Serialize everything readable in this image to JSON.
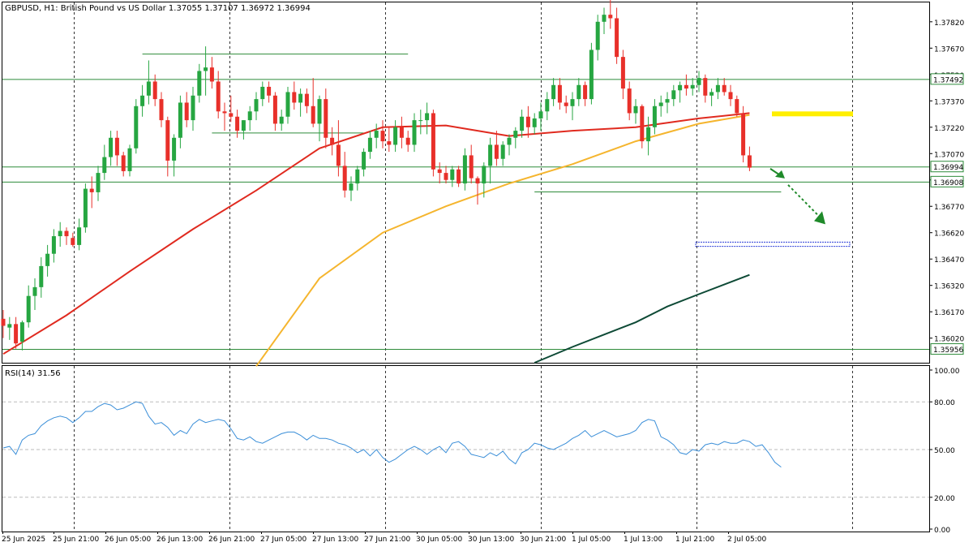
{
  "header": {
    "symbol_info": "GBPUSD, H1:  British Pound vs US Dollar  1.37055 1.37107 1.36972 1.36994"
  },
  "indicator": {
    "label": "RSI(14) 31.56"
  },
  "price_axis": {
    "ticks": [
      "1.37820",
      "1.37670",
      "1.37520",
      "1.37370",
      "1.37220",
      "1.37070",
      "1.36920",
      "1.36770",
      "1.36620",
      "1.36470",
      "1.36320",
      "1.36170",
      "1.36020"
    ],
    "tick_values": [
      1.3782,
      1.3767,
      1.3752,
      1.3737,
      1.3722,
      1.3707,
      1.3692,
      1.3677,
      1.3662,
      1.3647,
      1.3632,
      1.3617,
      1.3602
    ],
    "range": [
      1.3588,
      1.3793
    ]
  },
  "rsi_axis": {
    "ticks": [
      "100.00",
      "80.00",
      "50.00",
      "20.00",
      "0.00"
    ],
    "tick_values": [
      100,
      80,
      50,
      20,
      0
    ]
  },
  "time_axis": {
    "labels": [
      "25 Jun 2025",
      "25 Jun 21:00",
      "26 Jun 05:00",
      "26 Jun 13:00",
      "26 Jun 21:00",
      "27 Jun 05:00",
      "27 Jun 13:00",
      "27 Jun 21:00",
      "30 Jun 05:00",
      "30 Jun 13:00",
      "30 Jun 21:00",
      "1 Jul 05:00",
      "1 Jul 13:00",
      "1 Jul 21:00",
      "2 Jul 05:00"
    ]
  },
  "price_labels": [
    {
      "text": "1.37492",
      "value": 1.37492
    },
    {
      "text": "1.36994",
      "value": 1.36994
    },
    {
      "text": "1.36908",
      "value": 1.36908
    },
    {
      "text": "1.35956",
      "value": 1.35956
    }
  ],
  "colors": {
    "bull": "#26a641",
    "bear": "#e8302a",
    "ma_fast": "#e02a1f",
    "ma_slow": "#f5b52e",
    "ma_long": "#0e4a36",
    "rsi": "#3a8ed8",
    "level": "#2e8b3a",
    "zone_yellow": "#ffef00",
    "zone_blue": "#2a3cd8",
    "arrow": "#1f8a2a"
  },
  "chart_data": {
    "type": "candlestick",
    "symbol": "GBPUSD",
    "timeframe": "H1",
    "ohlc_current": {
      "open": 1.37055,
      "high": 1.37107,
      "low": 1.36972,
      "close": 1.36994
    },
    "candles": [
      [
        1.3613,
        1.3618,
        1.3602,
        1.3609
      ],
      [
        1.3608,
        1.3614,
        1.3601,
        1.361
      ],
      [
        1.361,
        1.3614,
        1.3596,
        1.3599
      ],
      [
        1.36,
        1.3612,
        1.3595,
        1.3611
      ],
      [
        1.3611,
        1.3632,
        1.3608,
        1.3626
      ],
      [
        1.3626,
        1.3636,
        1.3618,
        1.3631
      ],
      [
        1.3631,
        1.3648,
        1.3625,
        1.3643
      ],
      [
        1.3643,
        1.3655,
        1.3637,
        1.365
      ],
      [
        1.365,
        1.3664,
        1.3645,
        1.366
      ],
      [
        1.366,
        1.3668,
        1.3654,
        1.3663
      ],
      [
        1.3663,
        1.3665,
        1.3655,
        1.366
      ],
      [
        1.3659,
        1.3662,
        1.3654,
        1.3655
      ],
      [
        1.3655,
        1.367,
        1.3652,
        1.3665
      ],
      [
        1.3665,
        1.369,
        1.3662,
        1.3687
      ],
      [
        1.3687,
        1.3694,
        1.3676,
        1.3685
      ],
      [
        1.3685,
        1.37,
        1.368,
        1.3696
      ],
      [
        1.3696,
        1.3712,
        1.3692,
        1.3705
      ],
      [
        1.3705,
        1.372,
        1.37,
        1.3716
      ],
      [
        1.3716,
        1.372,
        1.37,
        1.3706
      ],
      [
        1.3706,
        1.3708,
        1.3694,
        1.3697
      ],
      [
        1.3697,
        1.3712,
        1.3694,
        1.371
      ],
      [
        1.371,
        1.3738,
        1.3707,
        1.3734
      ],
      [
        1.3734,
        1.3746,
        1.3728,
        1.374
      ],
      [
        1.374,
        1.376,
        1.3735,
        1.3748
      ],
      [
        1.3748,
        1.3752,
        1.3734,
        1.3738
      ],
      [
        1.3738,
        1.3742,
        1.3722,
        1.3726
      ],
      [
        1.3726,
        1.3728,
        1.3694,
        1.3703
      ],
      [
        1.3703,
        1.3718,
        1.3694,
        1.3716
      ],
      [
        1.3716,
        1.374,
        1.371,
        1.3736
      ],
      [
        1.3736,
        1.3742,
        1.3722,
        1.3726
      ],
      [
        1.3726,
        1.3745,
        1.372,
        1.374
      ],
      [
        1.374,
        1.3758,
        1.3736,
        1.3754
      ],
      [
        1.3754,
        1.3768,
        1.374,
        1.3756
      ],
      [
        1.3756,
        1.3762,
        1.3744,
        1.3748
      ],
      [
        1.3748,
        1.3754,
        1.3727,
        1.3731
      ],
      [
        1.3731,
        1.3736,
        1.372,
        1.373
      ],
      [
        1.373,
        1.374,
        1.3725,
        1.3728
      ],
      [
        1.3728,
        1.3732,
        1.3716,
        1.372
      ],
      [
        1.372,
        1.3726,
        1.3715,
        1.3726
      ],
      [
        1.3726,
        1.3734,
        1.372,
        1.3731
      ],
      [
        1.3731,
        1.3742,
        1.3726,
        1.3738
      ],
      [
        1.3738,
        1.3748,
        1.3734,
        1.3745
      ],
      [
        1.3745,
        1.3748,
        1.3736,
        1.374
      ],
      [
        1.374,
        1.3742,
        1.372,
        1.3724
      ],
      [
        1.3724,
        1.3732,
        1.372,
        1.3728
      ],
      [
        1.3728,
        1.3745,
        1.3724,
        1.3742
      ],
      [
        1.3742,
        1.3748,
        1.3732,
        1.3736
      ],
      [
        1.3736,
        1.3744,
        1.3728,
        1.3741
      ],
      [
        1.3741,
        1.3744,
        1.373,
        1.3734
      ],
      [
        1.3734,
        1.375,
        1.3722,
        1.3724
      ],
      [
        1.3724,
        1.374,
        1.3714,
        1.3738
      ],
      [
        1.3738,
        1.3744,
        1.371,
        1.3716
      ],
      [
        1.3716,
        1.3722,
        1.3706,
        1.3712
      ],
      [
        1.3712,
        1.3726,
        1.3694,
        1.37
      ],
      [
        1.37,
        1.3708,
        1.3682,
        1.3686
      ],
      [
        1.3686,
        1.3694,
        1.368,
        1.369
      ],
      [
        1.369,
        1.37,
        1.3686,
        1.3698
      ],
      [
        1.3698,
        1.371,
        1.3694,
        1.3708
      ],
      [
        1.3708,
        1.372,
        1.3704,
        1.3716
      ],
      [
        1.3716,
        1.3724,
        1.371,
        1.372
      ],
      [
        1.372,
        1.3726,
        1.371,
        1.3714
      ],
      [
        1.3714,
        1.3722,
        1.3708,
        1.3712
      ],
      [
        1.3712,
        1.3726,
        1.3708,
        1.3722
      ],
      [
        1.3722,
        1.3728,
        1.371,
        1.3716
      ],
      [
        1.3716,
        1.372,
        1.3708,
        1.3712
      ],
      [
        1.3712,
        1.373,
        1.3708,
        1.3726
      ],
      [
        1.3726,
        1.3732,
        1.3718,
        1.3726
      ],
      [
        1.3726,
        1.3736,
        1.3718,
        1.373
      ],
      [
        1.373,
        1.3732,
        1.3694,
        1.3698
      ],
      [
        1.3698,
        1.3702,
        1.369,
        1.3696
      ],
      [
        1.3696,
        1.37,
        1.369,
        1.3692
      ],
      [
        1.3692,
        1.37,
        1.3688,
        1.3698
      ],
      [
        1.3698,
        1.37,
        1.3688,
        1.369
      ],
      [
        1.369,
        1.371,
        1.3686,
        1.3706
      ],
      [
        1.3706,
        1.3712,
        1.369,
        1.3693
      ],
      [
        1.3693,
        1.3694,
        1.3678,
        1.369
      ],
      [
        1.369,
        1.3702,
        1.3682,
        1.37
      ],
      [
        1.37,
        1.3716,
        1.369,
        1.3712
      ],
      [
        1.3712,
        1.372,
        1.37,
        1.3704
      ],
      [
        1.3704,
        1.3714,
        1.37,
        1.3712
      ],
      [
        1.3712,
        1.3718,
        1.3706,
        1.3716
      ],
      [
        1.3716,
        1.3722,
        1.371,
        1.372
      ],
      [
        1.372,
        1.3732,
        1.3716,
        1.3728
      ],
      [
        1.3728,
        1.3734,
        1.3716,
        1.3722
      ],
      [
        1.3722,
        1.373,
        1.3718,
        1.3727
      ],
      [
        1.3727,
        1.3736,
        1.372,
        1.3731
      ],
      [
        1.3731,
        1.3742,
        1.3726,
        1.3738
      ],
      [
        1.3738,
        1.375,
        1.3734,
        1.3746
      ],
      [
        1.3746,
        1.375,
        1.3732,
        1.3736
      ],
      [
        1.3736,
        1.374,
        1.373,
        1.3734
      ],
      [
        1.3734,
        1.3742,
        1.3726,
        1.3738
      ],
      [
        1.3738,
        1.375,
        1.3734,
        1.3746
      ],
      [
        1.3746,
        1.3748,
        1.3734,
        1.3738
      ],
      [
        1.3738,
        1.377,
        1.3735,
        1.3766
      ],
      [
        1.3766,
        1.3786,
        1.376,
        1.3782
      ],
      [
        1.3782,
        1.379,
        1.3775,
        1.3786
      ],
      [
        1.3786,
        1.3796,
        1.3778,
        1.3784
      ],
      [
        1.3784,
        1.379,
        1.3758,
        1.3762
      ],
      [
        1.3762,
        1.3766,
        1.3738,
        1.3744
      ],
      [
        1.3744,
        1.3748,
        1.3726,
        1.373
      ],
      [
        1.373,
        1.3738,
        1.3724,
        1.3734
      ],
      [
        1.3734,
        1.3735,
        1.371,
        1.3714
      ],
      [
        1.3714,
        1.3728,
        1.3706,
        1.3722
      ],
      [
        1.3722,
        1.3738,
        1.3718,
        1.3734
      ],
      [
        1.3734,
        1.374,
        1.3728,
        1.3736
      ],
      [
        1.3736,
        1.3742,
        1.373,
        1.3738
      ],
      [
        1.3738,
        1.3746,
        1.3734,
        1.3743
      ],
      [
        1.3743,
        1.3748,
        1.3736,
        1.3746
      ],
      [
        1.3746,
        1.3752,
        1.374,
        1.3744
      ],
      [
        1.3744,
        1.375,
        1.374,
        1.3746
      ],
      [
        1.3746,
        1.3754,
        1.3742,
        1.375
      ],
      [
        1.375,
        1.3752,
        1.3736,
        1.374
      ],
      [
        1.374,
        1.3744,
        1.3734,
        1.3742
      ],
      [
        1.3742,
        1.375,
        1.3738,
        1.3746
      ],
      [
        1.3746,
        1.375,
        1.374,
        1.3742
      ],
      [
        1.3742,
        1.3746,
        1.3734,
        1.3738
      ],
      [
        1.3738,
        1.374,
        1.3728,
        1.373
      ],
      [
        1.373,
        1.3734,
        1.3702,
        1.3706
      ],
      [
        1.3706,
        1.3711,
        1.3697,
        1.3699
      ]
    ],
    "series": [
      {
        "name": "",
        "color": "#e02a1f",
        "x": [
          0,
          10,
          20,
          30,
          40,
          50,
          60,
          70,
          80,
          90,
          100,
          110,
          118
        ],
        "values": [
          1.3593,
          1.3615,
          1.364,
          1.3664,
          1.3686,
          1.371,
          1.3722,
          1.3723,
          1.3717,
          1.372,
          1.3722,
          1.3727,
          1.373
        ]
      },
      {
        "name": "",
        "color": "#f5b52e",
        "x": [
          40,
          50,
          60,
          70,
          80,
          90,
          100,
          110,
          118
        ],
        "values": [
          1.3586,
          1.3636,
          1.3662,
          1.3677,
          1.369,
          1.3701,
          1.3714,
          1.3724,
          1.3729
        ]
      },
      {
        "name": "",
        "color": "#0e4a36",
        "x": [
          84,
          90,
          95,
          100,
          105,
          110,
          118
        ],
        "values": [
          1.3588,
          1.3597,
          1.3604,
          1.3611,
          1.362,
          1.3627,
          1.3638
        ]
      }
    ],
    "rsi": {
      "name": "RSI(14)",
      "values": [
        51,
        52,
        47,
        56,
        59,
        60,
        65,
        68,
        70,
        71,
        70,
        67,
        70,
        74,
        74,
        77,
        79,
        78,
        75,
        76,
        78,
        80,
        79,
        71,
        66,
        67,
        64,
        59,
        62,
        60,
        66,
        69,
        67,
        68,
        69,
        68,
        63,
        57,
        56,
        58,
        55,
        54,
        56,
        58,
        60,
        61,
        61,
        59,
        56,
        59,
        57,
        57,
        56,
        54,
        53,
        51,
        48,
        50,
        46,
        50,
        45,
        42,
        44,
        47,
        50,
        52,
        50,
        47,
        50,
        52,
        48,
        54,
        55,
        52,
        47,
        46,
        45,
        48,
        46,
        49,
        44,
        41,
        48,
        50,
        54,
        53,
        51,
        50,
        52,
        54,
        57,
        59,
        62,
        58,
        60,
        62,
        60,
        58,
        59,
        60,
        62,
        67,
        69,
        68,
        58,
        56,
        53,
        48,
        47,
        50,
        49,
        53,
        54,
        53,
        55,
        54,
        54,
        56,
        55,
        52,
        53,
        48,
        42,
        39
      ]
    },
    "levels": [
      1.37492,
      1.36994,
      1.36908,
      1.35956
    ],
    "resistance_segments": [
      {
        "from": 22,
        "to": 64,
        "value": 1.37636
      },
      {
        "from": 33,
        "to": 57,
        "value": 1.37187
      },
      {
        "from": 84,
        "to": 123,
        "value": 1.36852
      }
    ],
    "target_zone": {
      "value_top": 1.36566,
      "value_bottom": 1.36542
    },
    "marker_zone": {
      "value": 1.37296
    },
    "forecast_arrow": {
      "from_value": 1.36984,
      "to_value": 1.36677
    },
    "ylim": [
      1.3588,
      1.3793
    ],
    "rsi_ylim": [
      0,
      100
    ]
  }
}
